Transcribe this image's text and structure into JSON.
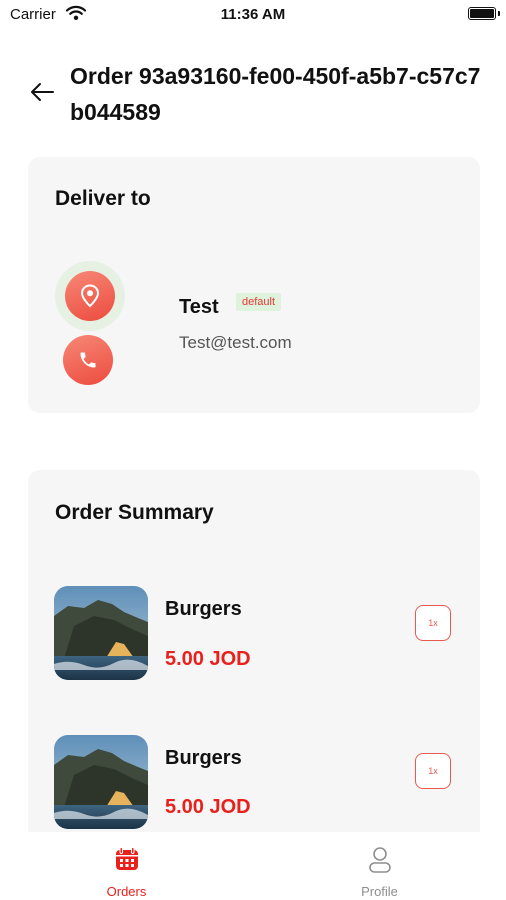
{
  "status_bar": {
    "carrier": "Carrier",
    "time": "11:36 AM"
  },
  "header": {
    "title": "Order 93a93160-fe00-450f-a5b7-c57c7b044589"
  },
  "deliver": {
    "title": "Deliver to",
    "name": "Test",
    "badge": "default",
    "email": "Test@test.com"
  },
  "summary": {
    "title": "Order Summary",
    "items": [
      {
        "name": "Burgers",
        "price": "5.00 JOD",
        "qty": "1x"
      },
      {
        "name": "Burgers",
        "price": "5.00 JOD",
        "qty": "1x"
      }
    ]
  },
  "tabs": [
    {
      "label": "Orders",
      "icon": "calendar-icon",
      "active": true
    },
    {
      "label": "Profile",
      "icon": "user-icon",
      "active": false
    }
  ],
  "colors": {
    "accent": "#e8211c",
    "badge_bg": "#dff2dc",
    "card_bg": "#f6f6f6",
    "tab_active": "#e8211c",
    "tab_inactive": "#8e8e8e"
  }
}
